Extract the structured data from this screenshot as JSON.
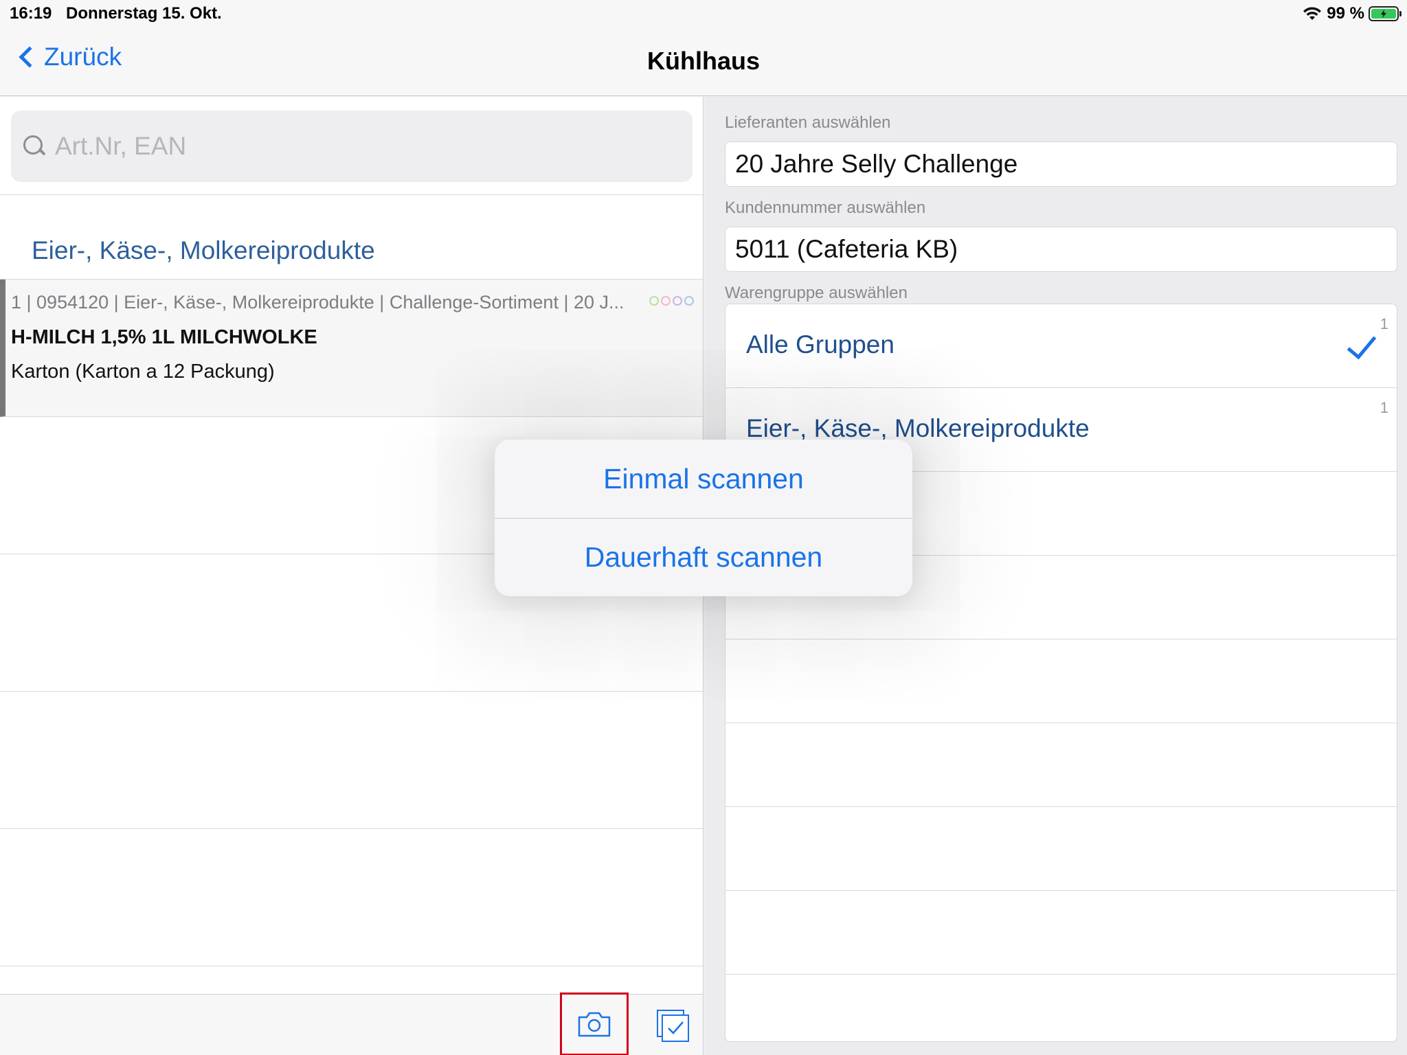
{
  "status": {
    "time": "16:19",
    "date": "Donnerstag 15. Okt.",
    "battery": "99 %"
  },
  "nav": {
    "back_label": "Zurück",
    "title": "Kühlhaus"
  },
  "search": {
    "placeholder": "Art.Nr, EAN"
  },
  "list": {
    "section_title": "Eier-, Käse-, Molkereiprodukte",
    "items": [
      {
        "meta": "1 | 0954120 | Eier-, Käse-, Molkereiprodukte | Challenge-Sortiment | 20 J...",
        "name": "H-MILCH 1,5% 1L MILCHWOLKE",
        "unit": "Karton (Karton a 12 Packung)",
        "dot_colors": [
          "#b8e0a0",
          "#f4b8c8",
          "#d0b0e8",
          "#a8c8e8"
        ]
      }
    ]
  },
  "toolbar": {
    "camera_icon": "camera-icon",
    "select_icon": "checkbox-stack-icon"
  },
  "form": {
    "supplier_label": "Lieferanten auswählen",
    "supplier_value": "20 Jahre Selly Challenge",
    "customer_label": "Kundennummer auswählen",
    "customer_value": "5011 (Cafeteria KB)",
    "group_label": "Warengruppe auswählen",
    "groups": [
      {
        "name": "Alle Gruppen",
        "count": "1",
        "selected": true
      },
      {
        "name": "Eier-, Käse-, Molkereiprodukte",
        "count": "1",
        "selected": false
      }
    ]
  },
  "popover": {
    "scan_once": "Einmal scannen",
    "scan_continuous": "Dauerhaft scannen"
  },
  "colors": {
    "accent": "#1a73e8",
    "highlight_border": "#d0021b",
    "battery": "#34c759"
  }
}
